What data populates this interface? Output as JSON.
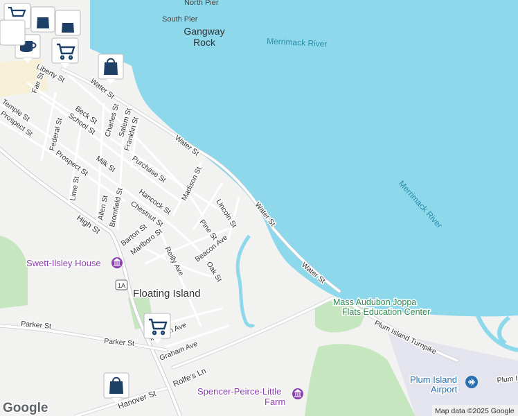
{
  "water_labels": [
    "Merrimack River",
    "Merrimack River"
  ],
  "piers": [
    "North Pier",
    "South Pier"
  ],
  "landmark": [
    "Gangway",
    "Rock"
  ],
  "place": "Floating Island",
  "pois": {
    "swett_ilsley": "Swett-Ilsley House",
    "audubon": [
      "Mass Audubon Joppa",
      "Flats Education Center"
    ],
    "spencer": [
      "Spencer-Peirce-Little",
      "Farm"
    ],
    "airport": [
      "Plum Island",
      "Airport"
    ]
  },
  "streets": {
    "water_st": "Water St",
    "liberty": "Liberty St",
    "fair": "Fair St",
    "temple": "Temple St",
    "prospect_top": "Prospect St",
    "beck": "Beck St",
    "school": "School St",
    "charles": "Charles St",
    "salem": "Salem St",
    "franklin": "Franklin St",
    "federal": "Federal St",
    "prospect": "Prospect St",
    "milk": "Milk St",
    "purchase": "Purchase St",
    "madison": "Madison St",
    "lime": "Lime St",
    "allen": "Allen St",
    "bromfield": "Bromfield St",
    "hancock": "Hancock St",
    "chestnut": "Chestnut St",
    "lincoln": "Lincoln St",
    "high": "High St",
    "pine": "Pine St",
    "barton": "Barton St",
    "marlboro": "Marlboro St",
    "beacon": "Beacon Ave",
    "reilly": "Reilly Ave",
    "oak": "Oak St",
    "route": "1A",
    "parker": "Parker St",
    "morgan": "Morgan Ave",
    "graham": "Graham Ave",
    "rolfes": "Rolfe's Ln",
    "hanover": "Hanover St",
    "plum_tpk": "Plum Island Turnpike",
    "plum_trunc": "Plum I"
  },
  "attribution": "Map data ©2025 Google",
  "logo": "Google",
  "colors": {
    "water": "#8ed8ec",
    "land": "#f2f2f0",
    "park": "#c6e6c0",
    "poi_purple": "#8a3fae",
    "marker_blue": "#1e5aa8"
  }
}
